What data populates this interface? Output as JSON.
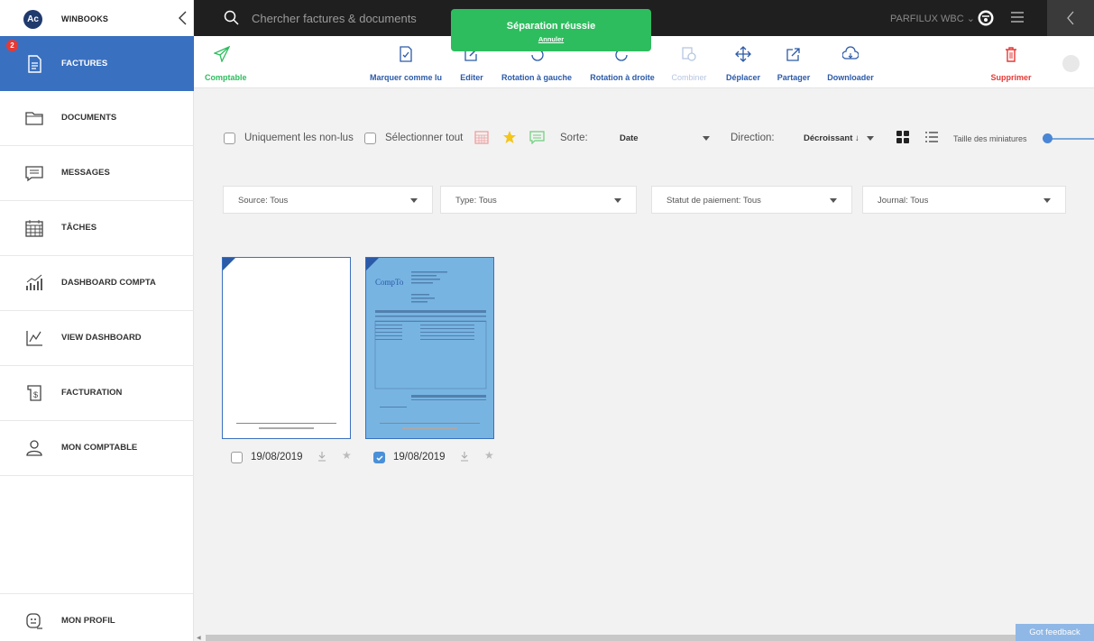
{
  "sidebar": {
    "logo_text": "Ac",
    "app_name": "WINBOOKS",
    "items": [
      {
        "label": "FACTURES",
        "icon": "invoice-icon",
        "badge": "2",
        "active": true
      },
      {
        "label": "DOCUMENTS",
        "icon": "folder-icon"
      },
      {
        "label": "MESSAGES",
        "icon": "message-icon"
      },
      {
        "label": "TÂCHES",
        "icon": "calendar-icon"
      },
      {
        "label": "DASHBOARD COMPTA",
        "icon": "chart-icon"
      },
      {
        "label": "VIEW DASHBOARD",
        "icon": "line-chart-icon"
      },
      {
        "label": "FACTURATION",
        "icon": "billing-icon"
      },
      {
        "label": "MON COMPTABLE",
        "icon": "user-icon"
      }
    ],
    "profile_label": "MON PROFIL"
  },
  "topbar": {
    "search_placeholder": "Chercher factures & documents",
    "company": "PARFILUX WBC ⌄"
  },
  "toast": {
    "title": "Séparation réussie",
    "undo_label": "Annuler"
  },
  "toolbar": {
    "comptable": "Comptable",
    "mark_read": "Marquer comme lu",
    "edit": "Editer",
    "rotate_left": "Rotation à gauche",
    "rotate_right": "Rotation à droite",
    "combine": "Combiner",
    "move": "Déplacer",
    "share": "Partager",
    "download": "Downloader",
    "delete": "Supprimer"
  },
  "filters": {
    "only_unread": "Uniquement les non-lus",
    "select_all": "Sélectionner tout",
    "sort_label": "Sorte:",
    "sort_value": "Date",
    "direction_label": "Direction:",
    "direction_value": "Décroissant ↓",
    "thumb_size_label": "Taille des miniatures",
    "source": "Source: Tous",
    "type": "Type: Tous",
    "payment_status": "Statut de paiement: Tous",
    "journal": "Journal: Tous"
  },
  "documents": [
    {
      "date": "19/08/2019",
      "selected": false
    },
    {
      "date": "19/08/2019",
      "selected": true,
      "logo_text": "CompTo"
    }
  ],
  "feedback": "Got feedback",
  "colors": {
    "brand_blue": "#3a70c0",
    "toast_green": "#2ebd5e",
    "delete_red": "#e53935",
    "topbar_dark": "#1f1f1f"
  }
}
